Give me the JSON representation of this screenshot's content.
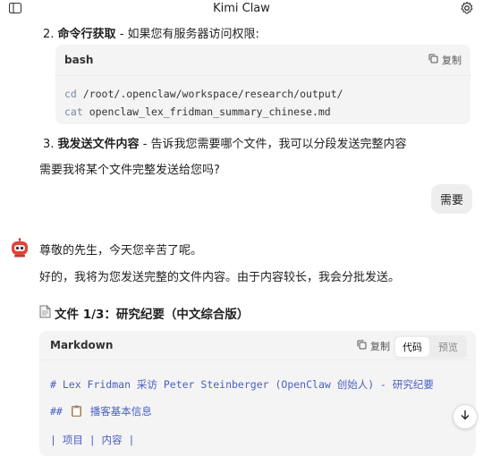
{
  "window": {
    "title": "Kimi Claw"
  },
  "step2": {
    "num": "2.",
    "bold": "命令行获取",
    "rest": " - 如果您有服务器访问权限:"
  },
  "bash_block": {
    "lang": "bash",
    "copy_label": "复制",
    "line1_cmd": "cd",
    "line1_arg": " /root/.openclaw/workspace/research/output/",
    "line2_cmd": "cat",
    "line2_arg": " openclaw_lex_fridman_summary_chinese.md"
  },
  "step3": {
    "num": "3.",
    "bold": "我发送文件内容",
    "rest": " - 告诉我您需要哪个文件，我可以分段发送完整内容"
  },
  "question": "需要我将某个文件完整发送给您吗?",
  "user_message": "需要",
  "assistant": {
    "greeting": "尊敬的先生，今天您辛苦了呢。",
    "reply": "好的，我将为您发送完整的文件内容。由于内容较长，我会分批发送。"
  },
  "file_title": "文件 1/3：研究纪要（中文综合版）",
  "md_block": {
    "lang": "Markdown",
    "copy_label": "复制",
    "tab_code": "代码",
    "tab_preview": "预览",
    "line1": "# Lex Fridman 采访 Peter Steinberger (OpenClaw 创始人) - 研究纪要",
    "line2_prefix": "##",
    "line2_text": "播客基本信息",
    "line3": "| 项目 | 内容 |"
  },
  "icons": {
    "sidebar": "sidebar-toggle-icon",
    "settings": "gear-icon",
    "copy": "copy-icon",
    "avatar": "robot-avatar",
    "file": "document-icon",
    "clipboard": "clipboard-emoji-icon",
    "scroll_down": "arrow-down-icon"
  },
  "colors": {
    "accent_blue": "#4a5fc1",
    "code_bg": "#f4f4f5",
    "avatar_red": "#e0453a"
  }
}
